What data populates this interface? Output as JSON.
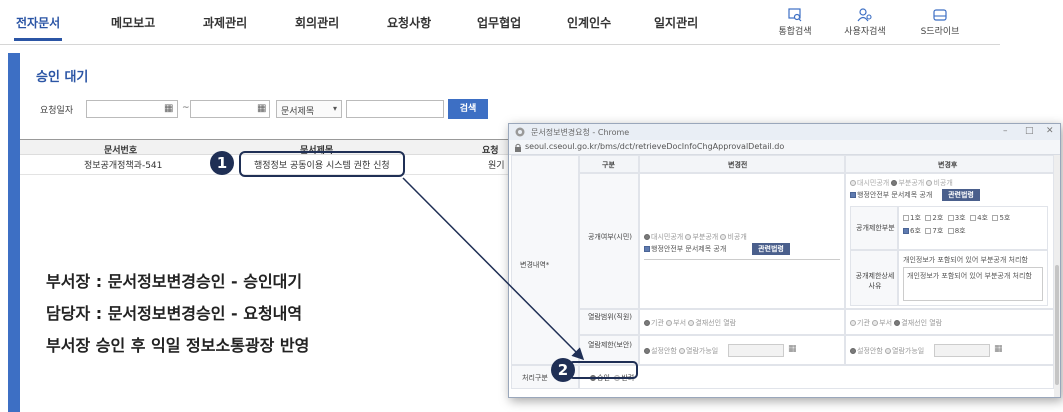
{
  "nav": {
    "items": [
      "전자문서",
      "메모보고",
      "과제관리",
      "회의관리",
      "요청사항",
      "업무협업",
      "인계인수",
      "일지관리"
    ],
    "tools": [
      {
        "label": "통합검색",
        "icon": "integrated-search-icon"
      },
      {
        "label": "사용자검색",
        "icon": "user-search-icon"
      },
      {
        "label": "S드라이브",
        "icon": "drive-icon"
      }
    ]
  },
  "page": {
    "title": "승인 대기",
    "search": {
      "date_label": "요청일자",
      "tilde": "~",
      "select_value": "문서제목",
      "search_button": "검색"
    },
    "table": {
      "headers": [
        "문서번호",
        "문서제목",
        "요청"
      ],
      "rows": [
        {
          "doc_no": "정보공개정책과-541",
          "title": "행정정보 공동이용 시스템 권한 신청",
          "req": "원기"
        }
      ]
    },
    "callouts": {
      "step1": "1",
      "step2": "2"
    },
    "notes": [
      "부서장 : 문서정보변경승인 - 승인대기",
      "담당자 : 문서정보변경승인 - 요청내역",
      "부서장 승인 후 익일 정보소통광장 반영"
    ]
  },
  "popup": {
    "title": "문서정보변경요청 - Chrome",
    "url": "seoul.cseoul.go.kr/bms/dct/retrieveDocInfoChgApprovalDetail.do",
    "headers": {
      "kind": "구분",
      "before": "변경전",
      "after": "변경후"
    },
    "section_label": "변경내역*",
    "rows": {
      "disclose_label": "공개여부(시민)",
      "range_label": "열람범위(직원)",
      "limit_label": "열람제한(보안)",
      "process_label": "처리구분"
    },
    "disclose_options": [
      "대시민공개",
      "부분공개",
      "비공개"
    ],
    "gov_doc_label": "행정안전부 문서제목 공개",
    "related_law_button": "관련법령",
    "limit_section_label": "공개제한부분",
    "limit_detail_label": "공개제한상세사유",
    "limit_items": [
      "1호",
      "2호",
      "3호",
      "4호",
      "5호",
      "6호",
      "7호",
      "8호"
    ],
    "limit_reason_text": "개인정보가 포함되어 있어 부분공개 처리함",
    "range_options": [
      "기관",
      "부서",
      "결재선인 열람"
    ],
    "limit_options": [
      "설정안함",
      "열람가능일"
    ],
    "process_options": [
      "승인",
      "반려"
    ],
    "window_controls": [
      "–",
      "□",
      "✕"
    ]
  }
}
